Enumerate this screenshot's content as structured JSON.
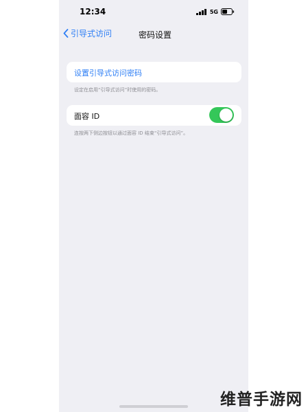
{
  "status_bar": {
    "time": "12:34",
    "network": "5G"
  },
  "nav": {
    "back_label": "引导式访问",
    "title": "密码设置"
  },
  "passcode": {
    "set_label": "设置引导式访问密码",
    "footnote": "设定在启用“引导式访问”时使用的密码。"
  },
  "face_id": {
    "label": "面容 ID",
    "enabled": true,
    "footnote": "连按两下侧边按钮以通过面容 ID 结束“引导式访问”。"
  },
  "watermark": "维普手游网",
  "colors": {
    "accent": "#2f7ff5",
    "toggle_on": "#34c759",
    "background": "#efeff4"
  }
}
